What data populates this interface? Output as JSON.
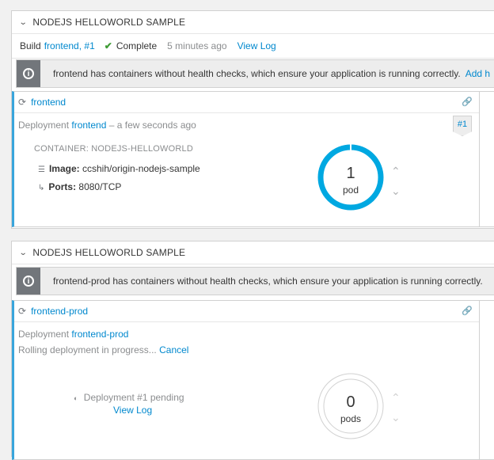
{
  "group1": {
    "title": "NODEJS HELLOWORLD SAMPLE",
    "build": {
      "prefix": "Build",
      "link": "frontend, #1",
      "status": "Complete",
      "time": "5 minutes ago",
      "log_link": "View Log"
    },
    "alert": {
      "text": "frontend has containers without health checks, which ensure your application is running correctly.",
      "link": "Add h"
    },
    "card": {
      "service": "frontend",
      "deployment_prefix": "Deployment",
      "deployment_link": "frontend",
      "deployment_suffix": "– a few seconds ago",
      "badge": "#1",
      "container_title": "CONTAINER: NODEJS-HELLOWORLD",
      "image_label": "Image:",
      "image_value": "ccshih/origin-nodejs-sample",
      "ports_label": "Ports:",
      "ports_value": "8080/TCP",
      "pod_count": "1",
      "pod_unit": "pod"
    }
  },
  "group2": {
    "title": "NODEJS HELLOWORLD SAMPLE",
    "alert": {
      "text": "frontend-prod has containers without health checks, which ensure your application is running correctly."
    },
    "card": {
      "service": "frontend-prod",
      "deployment_prefix": "Deployment",
      "deployment_link": "frontend-prod",
      "rolling_text": "Rolling deployment in progress...",
      "cancel_link": "Cancel",
      "pending_text": "Deployment #1 pending",
      "view_log": "View Log",
      "pod_count": "0",
      "pod_unit": "pods"
    }
  },
  "colors": {
    "accent": "#0088ce",
    "pod_ring": "#00a8e1",
    "card_border_left": "#39a5dc",
    "success": "#3f9c35",
    "alert_icon_bg": "#72767b"
  },
  "icons": [
    "chevron-down-icon",
    "check-icon",
    "info-icon",
    "service-icon",
    "link-icon",
    "layers-icon",
    "ports-icon",
    "chevron-up-icon",
    "spinner-icon"
  ]
}
